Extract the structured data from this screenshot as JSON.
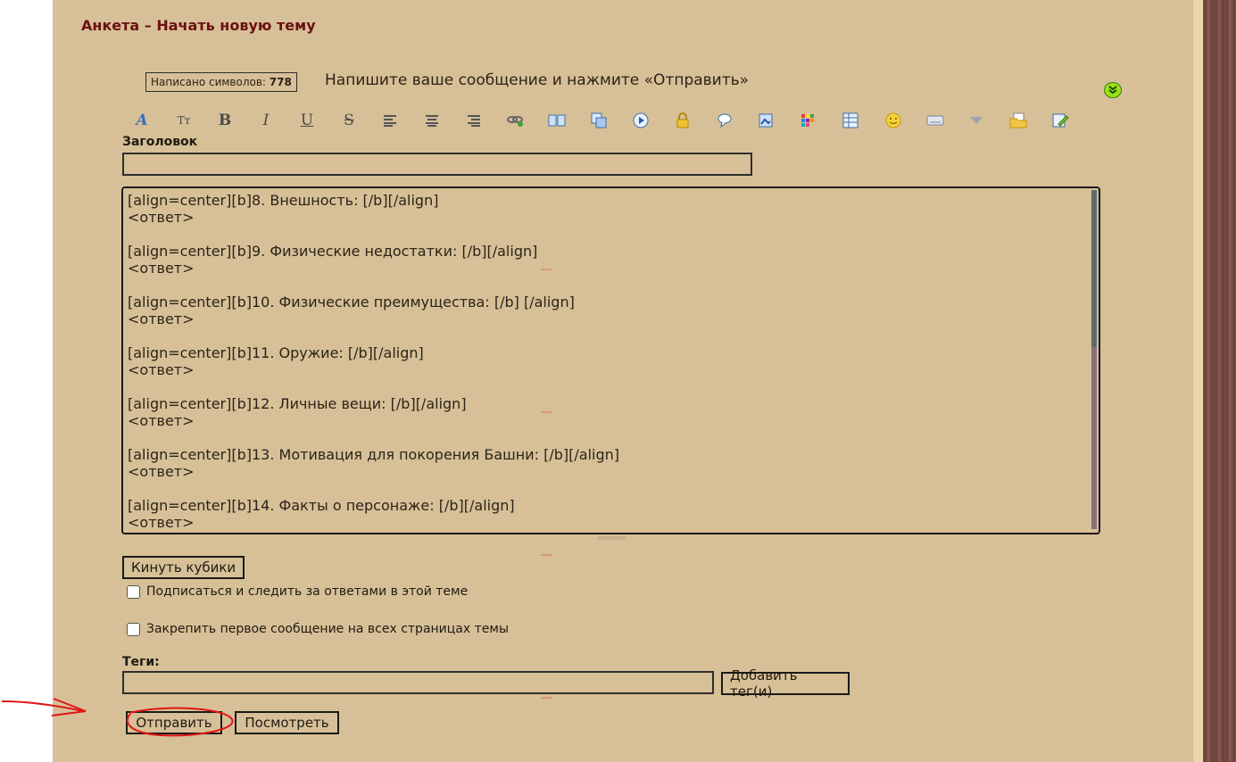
{
  "form": {
    "title": "Анкета – Начать новую тему",
    "char_counter_label": "Написано символов:",
    "char_count": "778",
    "instruction": "Напишите ваше сообщение и нажмите «Отправить»",
    "subject_label": "Заголовок",
    "subject_value": "",
    "message_text": "[align=center][b]8. Внешность: [/b][/align]\n<ответ>\n\n[align=center][b]9. Физические недостатки: [/b][/align]\n<ответ>\n\n[align=center][b]10. Физические преимущества: [/b] [/align]\n<ответ>\n\n[align=center][b]11. Оружие: [/b][/align]\n<ответ>\n\n[align=center][b]12. Личные вещи: [/b][/align]\n<ответ>\n\n[align=center][b]13. Мотивация для покорения Башни: [/b][/align]\n<ответ>\n\n[align=center][b]14. Факты о персонаже: [/b][/align]\n<ответ>",
    "dice_button": "Кинуть кубики",
    "subscribe_label": "Подписаться и следить за ответами в этой теме",
    "pin_label": "Закрепить первое сообщение на всех страницах темы",
    "tags_label": "Теги:",
    "tags_value": "",
    "add_tags_button": "Добавить тег(и)",
    "submit_button": "Отправить",
    "preview_button": "Посмотреть"
  },
  "toolbar": {
    "icons": [
      "font-icon",
      "font-size-icon",
      "bold-icon",
      "italic-icon",
      "underline-icon",
      "strikethrough-icon",
      "align-left-icon",
      "align-center-icon",
      "align-right-icon",
      "link-icon",
      "book-icon",
      "copy-icon",
      "media-play-icon",
      "lock-icon",
      "speech-bubble-icon",
      "picture-icon",
      "color-palette-icon",
      "table-icon",
      "smiley-icon",
      "keyboard-icon",
      "dropdown-arrow-icon",
      "folder-icon",
      "edit-icon"
    ],
    "glyphs": {
      "bold": "B",
      "italic": "I",
      "underline": "U",
      "strike": "S",
      "fontsize": "Tт",
      "font": "A"
    }
  },
  "colors": {
    "panel_bg": "#d7c097",
    "title_color": "#6b1111",
    "annotation_red": "#e01515",
    "collapse_green": "#9be01a"
  }
}
